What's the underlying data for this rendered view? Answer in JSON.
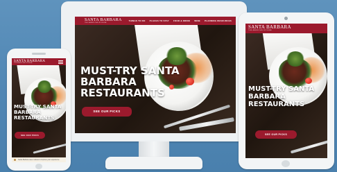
{
  "site": {
    "logo": "SANTA BARBARA",
    "tagline": "THE AMERICAN RIVIERA",
    "nav": [
      "THINGS TO DO",
      "PLACES TO STAY",
      "FOOD & DRINK",
      "WINE",
      "PLANNING RESOURCES"
    ],
    "hero_title_lines": [
      "MUST-TRY SANTA",
      "BARBARA",
      "RESTAURANTS"
    ],
    "cta_label": "SEE OUR PICKS"
  },
  "cookie_notice": "Santa Barbara uses cookies to improve your experience.",
  "colors": {
    "brand": "#9b1a2d",
    "background": "#5a8fbb",
    "device_frame": "#f3f5f6"
  }
}
